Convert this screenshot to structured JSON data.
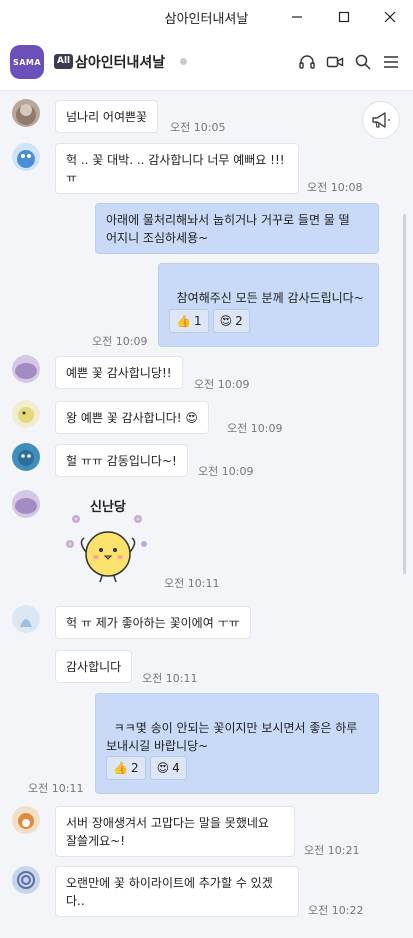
{
  "window": {
    "title": "삼아인터내셔날"
  },
  "header": {
    "avatar_text": "SAMA",
    "badge": "All",
    "room_name": "삼아인터내셔날"
  },
  "messages": [
    {
      "text": "넘나리 어여쁜꽃",
      "time": "오전 10:05"
    },
    {
      "text": "헉 .. 꽃 대박. .. 감사합니다 너무 예뻐요 !!!\nㅠ",
      "time": "오전 10:08"
    },
    {
      "text": "아래에 물처리해놔서 눕히거나 거꾸로 들면 물 떨\n어지니 조심하세용~"
    },
    {
      "text": "참여해주신 모든 분께 감사드립니다~",
      "time": "오전 10:09",
      "reactions": [
        {
          "icon": "thumbs-up",
          "count": "1"
        },
        {
          "icon": "heart-eyes",
          "count": "2"
        }
      ]
    },
    {
      "text": "예쁜 꽃 감사합니당!!",
      "time": "오전 10:09"
    },
    {
      "text": "왕 예쁜 꽃 감사합니다! 😍",
      "time": "오전 10:09"
    },
    {
      "text": "헐 ㅠㅠ 감동입니다~!",
      "time": "오전 10:09"
    },
    {
      "sticker_text": "신난당",
      "time": "오전 10:11"
    },
    {
      "text": "헉 ㅠ 제가 좋아하는 꽃이에여 ㅜㅠ"
    },
    {
      "text": "감사합니다",
      "time": "오전 10:11"
    },
    {
      "text": "ㅋㅋ몇 송이 안되는 꽃이지만 보시면서 좋은 하루\n보내시길 바랍니당~",
      "time": "오전 10:11",
      "reactions": [
        {
          "icon": "thumbs-up",
          "count": "2"
        },
        {
          "icon": "heart-eyes",
          "count": "4"
        }
      ]
    },
    {
      "text": "서버 장애생겨서 고맙다는 말을 못했네요\n잘쓸게요~!",
      "time": "오전 10:21"
    },
    {
      "text": "오랜만에 꽃 하이라이트에 추가할 수 있겠\n다..",
      "time": "오전 10:22"
    }
  ]
}
